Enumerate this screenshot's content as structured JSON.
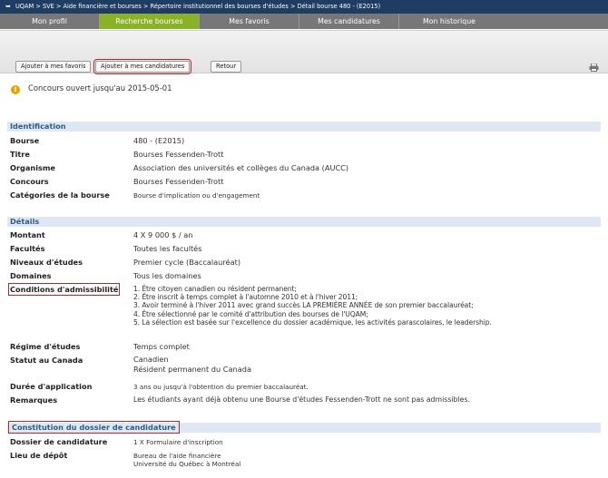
{
  "breadcrumb": {
    "items": [
      "UQAM",
      "SVE",
      "Aide financière et bourses",
      "Répertoire institutionnel des bourses d'études",
      "Détail bourse 480 - (E2015)"
    ],
    "separator": ">"
  },
  "tabs": [
    {
      "label": "Mon profil",
      "active": false
    },
    {
      "label": "Recherche bourses",
      "active": true
    },
    {
      "label": "Mes favoris",
      "active": false
    },
    {
      "label": "Mes candidatures",
      "active": false
    },
    {
      "label": "Mon historique",
      "active": false
    }
  ],
  "toolbar": {
    "add_favorites": "Ajouter à mes favoris",
    "add_applications": "Ajouter à mes candidatures",
    "back": "Retour"
  },
  "notice": "Concours ouvert jusqu'au 2015-05-01",
  "identification": {
    "header": "Identification",
    "bourse_label": "Bourse",
    "bourse_value": "480 - (E2015)",
    "titre_label": "Titre",
    "titre_value": "Bourses Fessenden-Trott",
    "organisme_label": "Organisme",
    "organisme_value": "Association des universités et collèges du Canada (AUCC)",
    "concours_label": "Concours",
    "concours_value": "Bourses Fessenden-Trott",
    "categories_label": "Catégories de la bourse",
    "categories_value": "Bourse d'implication ou d'engagement"
  },
  "details": {
    "header": "Détails",
    "montant_label": "Montant",
    "montant_value": "4 X 9 000 $ / an",
    "facultes_label": "Facultés",
    "facultes_value": "Toutes les facultés",
    "niveaux_label": "Niveaux d'études",
    "niveaux_value": "Premier cycle (Baccalauréat)",
    "domaines_label": "Domaines",
    "domaines_value": "Tous les domaines",
    "conditions_label": "Conditions d'admissibilité",
    "conditions": [
      "1. Être citoyen canadien ou résident permanent;",
      "2. Être inscrit à temps complet à l'automne 2010 et à l'hiver 2011;",
      "3. Avoir terminé à l'hiver 2011 avec grand succès LA PREMIÈRE ANNÉE de son premier baccalauréat;",
      "4. Être sélectionné par le comité d'attribution des bourses de l'UQAM;",
      "5. La sélection est basée sur l'excellence du dossier académique, les activités parascolaires, le leadership."
    ],
    "regime_label": "Régime d'études",
    "regime_value": "Temps complet",
    "statut_label": "Statut au Canada",
    "statut_values": [
      "Canadien",
      "Résident permanent du Canada"
    ],
    "duree_label": "Durée d'application",
    "duree_value": "3 ans ou jusqu'à l'obtention du premier baccalauréat.",
    "remarques_label": "Remarques",
    "remarques_value": "Les étudiants ayant déjà obtenu une Bourse d'études Fessenden-Trott ne sont pas admissibles."
  },
  "constitution": {
    "header": "Constitution du dossier de candidature",
    "dossier_label": "Dossier de candidature",
    "dossier_value": "1 X Formulaire d'inscription",
    "lieu_label": "Lieu de dépôt",
    "lieu_values": [
      "Bureau de l'aide financière",
      "Université du Québec à Montréal"
    ]
  },
  "colors": {
    "nav_bg": "#1f3d63",
    "tab_active": "#8ab227",
    "section_bg": "#dfe8f2",
    "section_text": "#2e5b8a",
    "highlight": "#b02a2a"
  }
}
